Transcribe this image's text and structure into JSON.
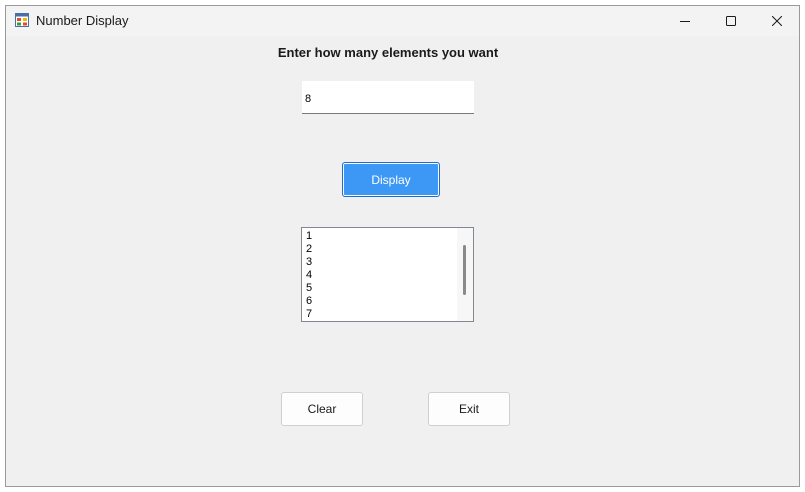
{
  "window": {
    "title": "Number Display",
    "icon": "app-form-icon",
    "controls": {
      "minimize": "minimize-icon",
      "maximize": "maximize-icon",
      "close": "close-icon"
    }
  },
  "form": {
    "prompt": "Enter how many elements you want",
    "count_input": {
      "value": "8",
      "placeholder": ""
    },
    "display_label": "Display",
    "list_items": [
      "1",
      "2",
      "3",
      "4",
      "5",
      "6",
      "7"
    ],
    "clear_label": "Clear",
    "exit_label": "Exit"
  },
  "colors": {
    "accent": "#3c97f5",
    "window_bg": "#f0f0f0"
  }
}
